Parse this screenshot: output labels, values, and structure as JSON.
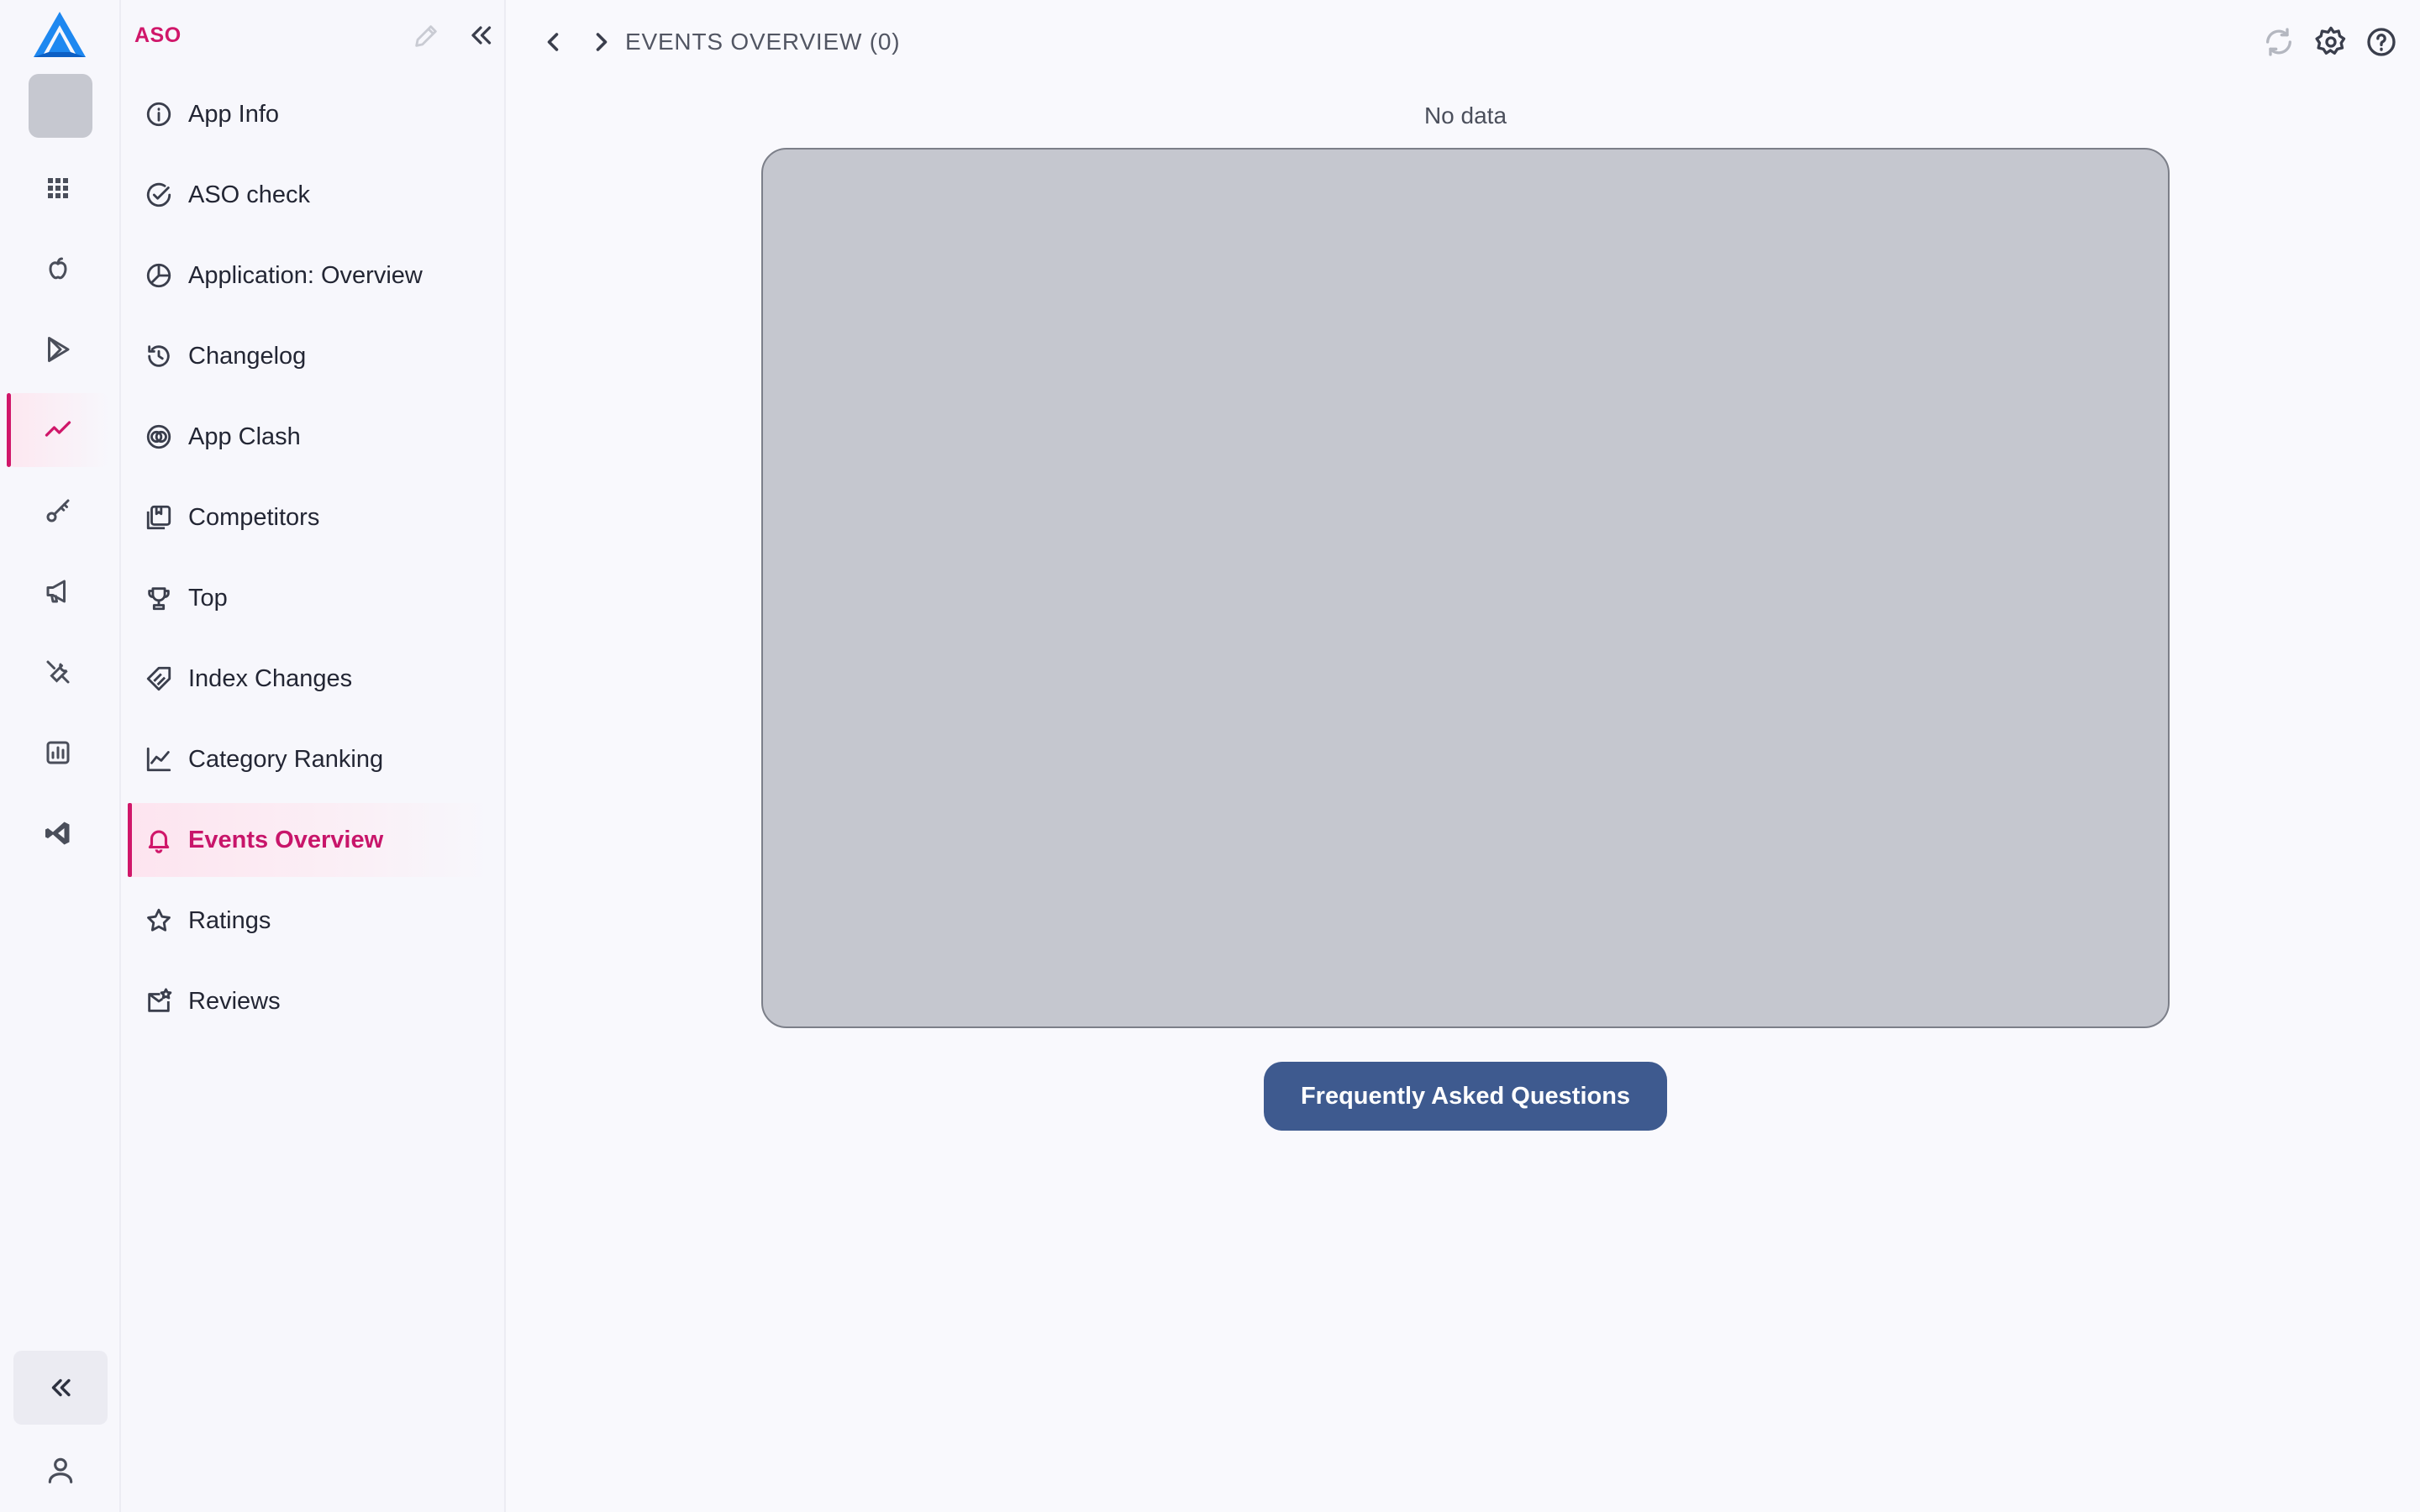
{
  "rail": {
    "items": [
      {
        "icon": "grid-icon"
      },
      {
        "icon": "apple-icon"
      },
      {
        "icon": "google-play-icon"
      },
      {
        "icon": "trending-icon",
        "active": true
      },
      {
        "icon": "key-icon"
      },
      {
        "icon": "megaphone-icon"
      },
      {
        "icon": "tools-icon"
      },
      {
        "icon": "report-chart-icon"
      },
      {
        "icon": "visual-studio-icon"
      }
    ],
    "collapse_icon": "double-chevron-left-icon",
    "user_icon": "user-icon"
  },
  "sidebar": {
    "title": "ASO",
    "items": [
      {
        "label": "App Info",
        "icon": "info-circle-icon"
      },
      {
        "label": "ASO check",
        "icon": "check-circle-icon"
      },
      {
        "label": "Application: Overview",
        "icon": "pie-chart-icon"
      },
      {
        "label": "Changelog",
        "icon": "history-icon"
      },
      {
        "label": "App Clash",
        "icon": "overlap-circles-icon"
      },
      {
        "label": "Competitors",
        "icon": "competitors-icon"
      },
      {
        "label": "Top",
        "icon": "trophy-icon"
      },
      {
        "label": "Index Changes",
        "icon": "tag-icon"
      },
      {
        "label": "Category Ranking",
        "icon": "line-chart-icon"
      },
      {
        "label": "Events Overview",
        "icon": "bell-icon",
        "active": true
      },
      {
        "label": "Ratings",
        "icon": "star-icon"
      },
      {
        "label": "Reviews",
        "icon": "mail-star-icon"
      }
    ]
  },
  "header": {
    "title": "EVENTS OVERVIEW (0)",
    "back_icon": "chevron-left-icon",
    "forward_icon": "chevron-right-icon",
    "actions": [
      "refresh-icon",
      "gear-icon",
      "help-icon"
    ]
  },
  "main": {
    "empty_text": "No data",
    "faq_button": "Frequently Asked Questions"
  },
  "colors": {
    "accent": "#d0176a",
    "button": "#3e5a8f",
    "placeholder": "#c5c7cf",
    "background": "#f9f9fd"
  }
}
